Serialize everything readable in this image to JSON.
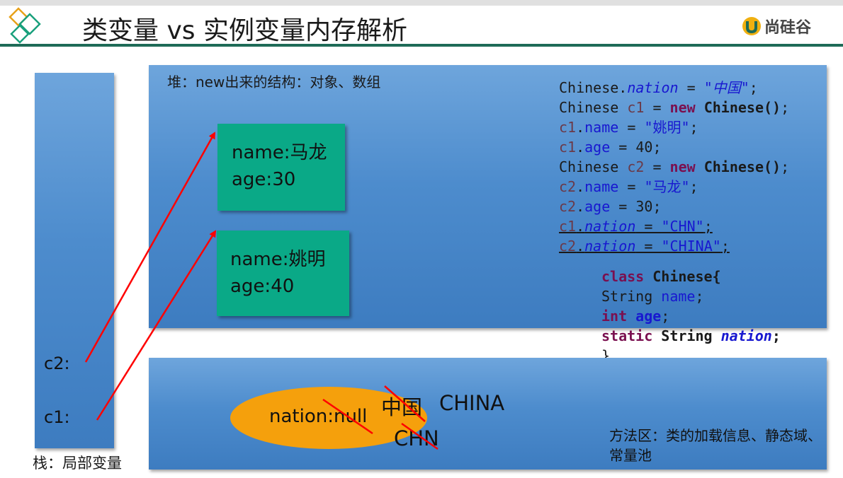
{
  "title": "类变量 vs 实例变量内存解析",
  "logo": {
    "text": "尚硅谷"
  },
  "stack": {
    "caption": "栈：局部变量",
    "vars": [
      "c2:",
      "c1:"
    ]
  },
  "heap": {
    "caption": "堆：new出来的结构：对象、数组",
    "objects": [
      {
        "name": "name:马龙",
        "age": "age:30"
      },
      {
        "name": "name:姚明",
        "age": "age:40"
      }
    ]
  },
  "code": {
    "lines": [
      "Chinese.nation = \"中国\";",
      "Chinese c1 = new Chinese();",
      "c1.name = \"姚明\";",
      "c1.age = 40;",
      "Chinese c2 = new Chinese();",
      "c2.name = \"马龙\";",
      "c2.age = 30;",
      "c1.nation = \"CHN\";",
      "c2.nation = \"CHINA\";"
    ],
    "class_def": [
      "class Chinese{",
      "String name;",
      "int age;",
      "static String nation;",
      "}"
    ]
  },
  "method_area": {
    "static_field": "nation:null",
    "values": [
      "中国",
      "CHINA",
      "CHN"
    ],
    "caption": "方法区：类的加载信息、静态域、常量池"
  },
  "colors": {
    "blue_area": "#4d8ccd",
    "object_box": "#0aa987",
    "ellipse": "#f5a00c",
    "arrow": "#ff0000",
    "title_rule": "#1e6b57",
    "keyword": "#7a1050",
    "field": "#1818d0"
  },
  "icons": [
    "diamond-logo-icon",
    "atguigu-logo-icon"
  ]
}
